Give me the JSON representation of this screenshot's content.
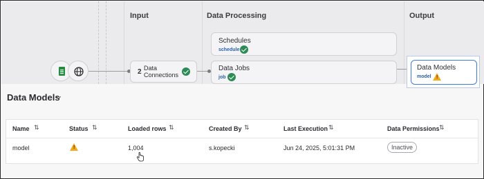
{
  "pipeline": {
    "columns": {
      "input": "Input",
      "processing": "Data Processing",
      "output": "Output"
    },
    "sources": {
      "sheets_icon": "sheets-icon",
      "globe_icon": "globe-icon"
    },
    "data_connections": {
      "count": "2",
      "label_line1": "Data",
      "label_line2": "Connections",
      "status": "ok"
    },
    "schedules": {
      "title": "Schedules",
      "tag": "schedule",
      "status": "ok"
    },
    "data_jobs": {
      "title": "Data Jobs",
      "tag": "job",
      "status": "ok"
    },
    "data_models": {
      "title": "Data Models",
      "tag": "model",
      "status": "warning"
    }
  },
  "section": {
    "title": "Data Models"
  },
  "table": {
    "headers": [
      "Name",
      "Status",
      "Loaded rows",
      "Created By",
      "Last Execution",
      "Data Permissions"
    ],
    "rows": [
      {
        "name": "model",
        "status": "warning",
        "loaded_rows": "1,004",
        "created_by": "s.kopecki",
        "last_execution": "Jun 24, 2025, 5:01:31 PM",
        "permission": "Inactive"
      }
    ]
  },
  "colors": {
    "accent": "#3b7dd8",
    "ok": "#2e8b57",
    "warning": "#f4a81c",
    "tag": "#2b5fa6"
  }
}
